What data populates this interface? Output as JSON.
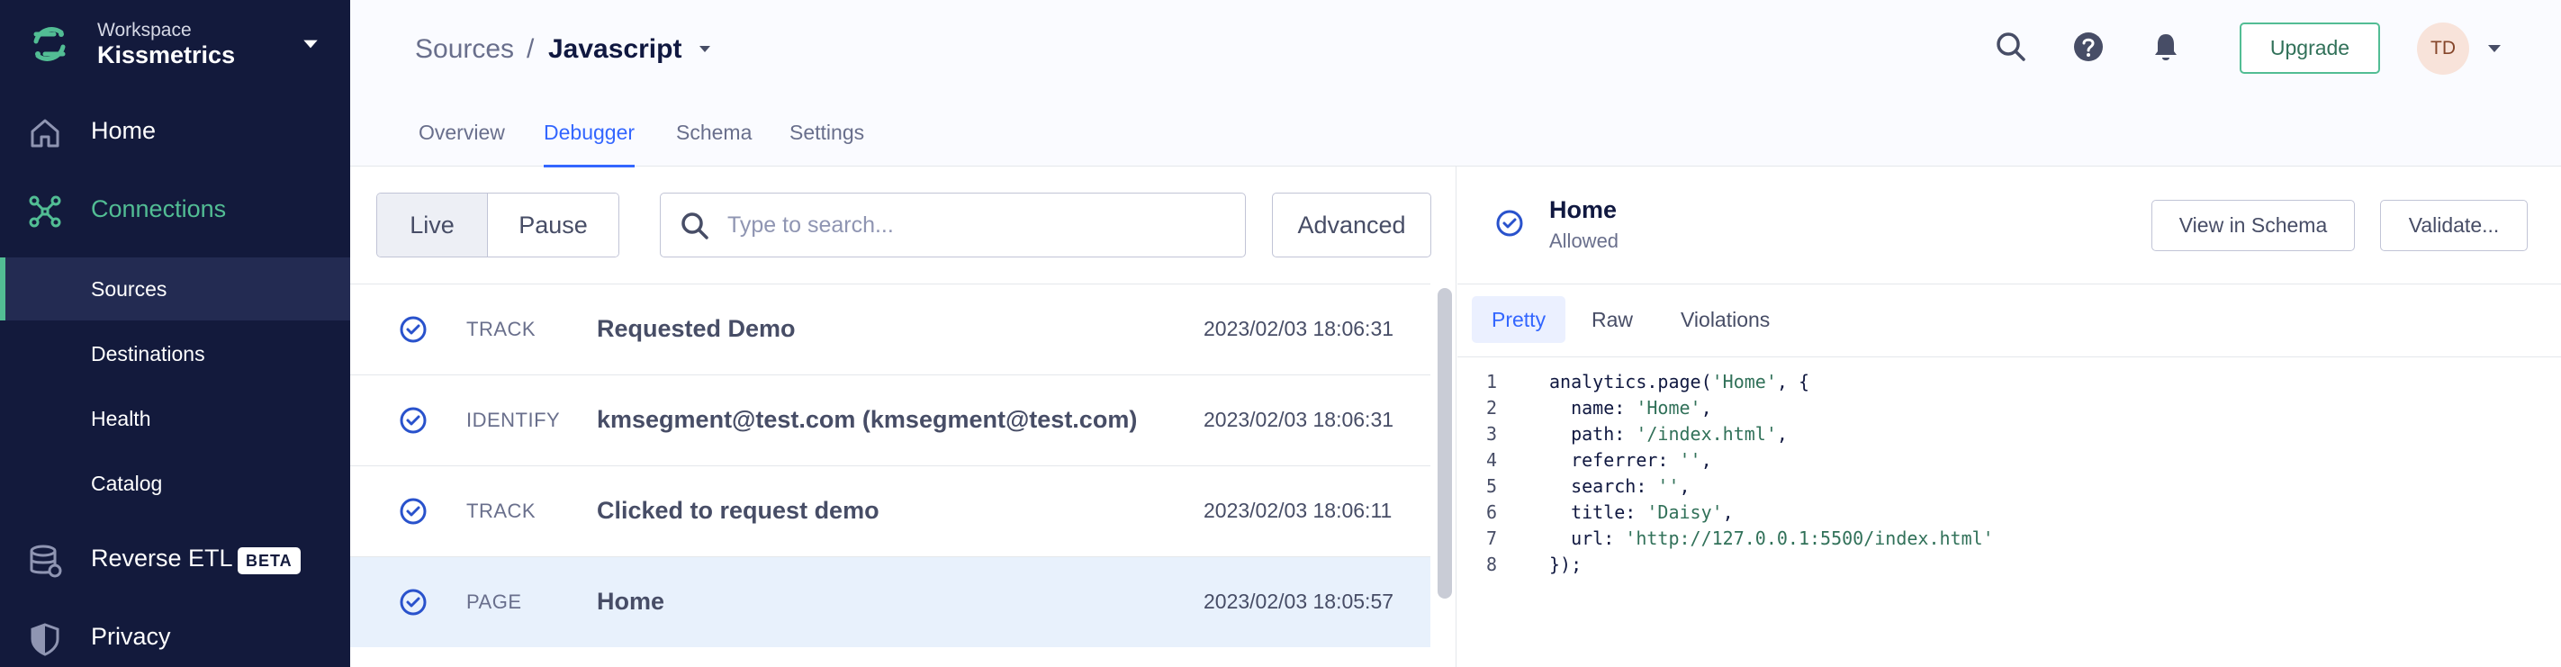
{
  "sidebar": {
    "workspace_label": "Workspace",
    "workspace_name": "Kissmetrics",
    "nav": [
      {
        "label": "Home",
        "icon": "home-icon"
      },
      {
        "label": "Connections",
        "icon": "connections-icon"
      },
      {
        "label": "Reverse ETL",
        "icon": "database-icon",
        "badge": "BETA"
      },
      {
        "label": "Privacy",
        "icon": "shield-icon"
      }
    ],
    "sub": [
      "Sources",
      "Destinations",
      "Health",
      "Catalog"
    ],
    "colors": {
      "bg": "#131a3c",
      "accent": "#52bd94"
    }
  },
  "header": {
    "crumb_parent": "Sources",
    "crumb_sep": "/",
    "crumb_current": "Javascript",
    "upgrade_label": "Upgrade",
    "avatar_initials": "TD",
    "tabs": [
      "Overview",
      "Debugger",
      "Schema",
      "Settings"
    ],
    "active_tab": "Debugger"
  },
  "toolbar": {
    "live_label": "Live",
    "pause_label": "Pause",
    "search_placeholder": "Type to search...",
    "advanced_label": "Advanced"
  },
  "events": [
    {
      "type": "TRACK",
      "name": "Requested Demo",
      "time": "2023/02/03 18:06:31"
    },
    {
      "type": "IDENTIFY",
      "name": "kmsegment@test.com (kmsegment@test.com)",
      "time": "2023/02/03 18:06:31"
    },
    {
      "type": "TRACK",
      "name": "Clicked to request demo",
      "time": "2023/02/03 18:06:11"
    },
    {
      "type": "PAGE",
      "name": "Home",
      "time": "2023/02/03 18:05:57"
    }
  ],
  "detail": {
    "title": "Home",
    "status": "Allowed",
    "view_schema_label": "View in Schema",
    "validate_label": "Validate...",
    "tabs": [
      "Pretty",
      "Raw",
      "Violations"
    ],
    "active_tab": "Pretty",
    "code": [
      {
        "n": "1",
        "pre": "analytics.page(",
        "str": "'Home'",
        "post": ", {"
      },
      {
        "n": "2",
        "pre": "  name: ",
        "str": "'Home'",
        "post": ","
      },
      {
        "n": "3",
        "pre": "  path: ",
        "str": "'/index.html'",
        "post": ","
      },
      {
        "n": "4",
        "pre": "  referrer: ",
        "str": "''",
        "post": ","
      },
      {
        "n": "5",
        "pre": "  search: ",
        "str": "''",
        "post": ","
      },
      {
        "n": "6",
        "pre": "  title: ",
        "str": "'Daisy'",
        "post": ","
      },
      {
        "n": "7",
        "pre": "  url: ",
        "str": "'http://127.0.0.1:5500/index.html'",
        "post": ""
      },
      {
        "n": "8",
        "pre": "});",
        "str": "",
        "post": ""
      }
    ]
  }
}
